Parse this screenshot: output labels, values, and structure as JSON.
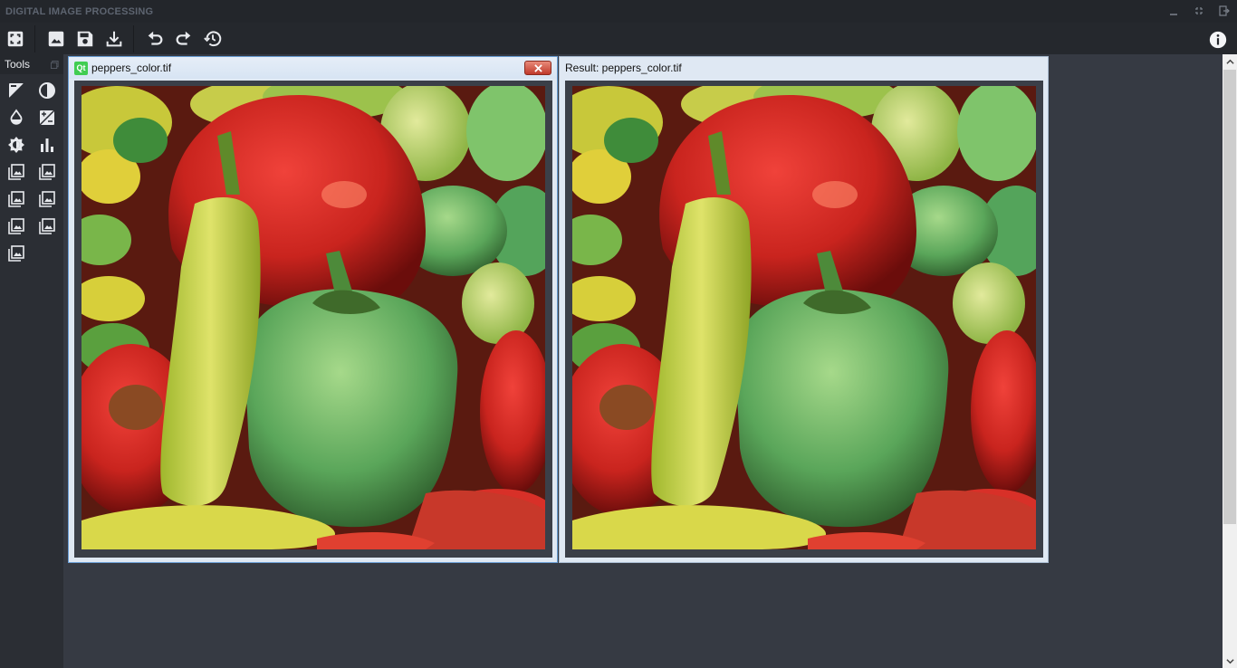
{
  "app": {
    "title": "DIGITAL IMAGE PROCESSING"
  },
  "window_controls": [
    "minimize-icon",
    "restore-icon",
    "exit-icon"
  ],
  "toolbar": {
    "buttons": [
      "fit-screen-icon",
      "open-image-icon",
      "save-icon",
      "download-icon",
      "undo-icon",
      "redo-icon",
      "history-icon"
    ],
    "info_icon": "info-icon"
  },
  "tools": {
    "title": "Tools",
    "items": [
      "image-half-icon",
      "contrast-icon",
      "drop-icon",
      "exposure-icon",
      "brightness-icon",
      "histogram-icon",
      "filter-icon",
      "filter-icon",
      "filter-icon",
      "filter-icon",
      "filter-icon",
      "filter-icon",
      "filter-icon"
    ]
  },
  "windows": {
    "source": {
      "title": "peppers_color.tif"
    },
    "result": {
      "title": "Result: peppers_color.tif"
    }
  },
  "colors": {
    "background": "#2b2e34",
    "mdi": "#363a43",
    "toolbar": "#25282d",
    "accent_qt": "#41cd52"
  }
}
